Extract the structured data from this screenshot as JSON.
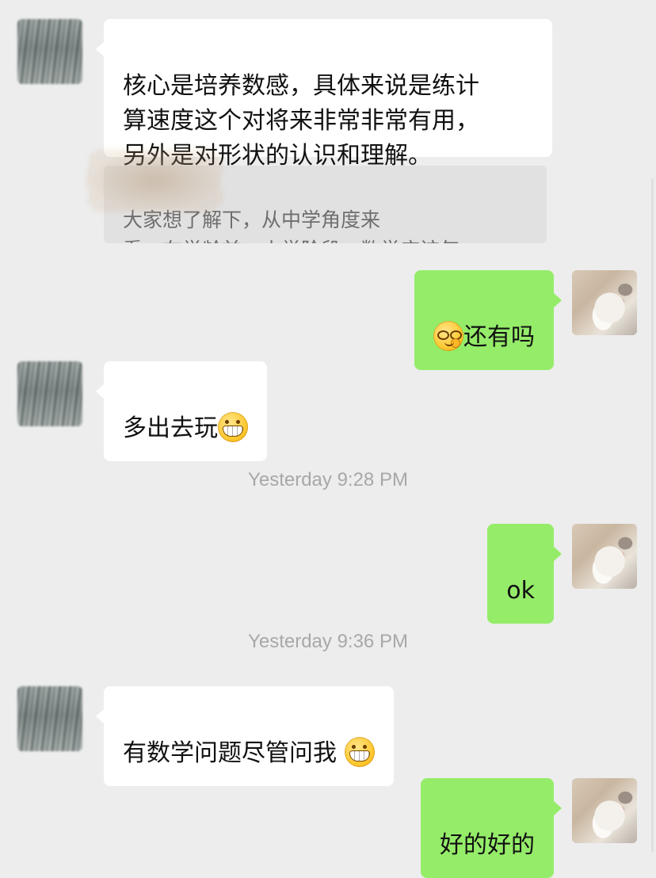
{
  "colors": {
    "background": "#ededed",
    "incoming_bubble": "#ffffff",
    "outgoing_bubble": "#95ec69",
    "quote_bg": "#e1e1e1",
    "timestamp_text": "#a8a8a8"
  },
  "messages": [
    {
      "sender": "other",
      "text": "核心是培养数感，具体来说是练计\n算速度这个对将来非常非常有用，\n另外是对形状的认识和理解。",
      "quote": {
        "text": "大家想了解下，从中学角度来\n看，在学龄前、小学阶段，数学应该怎..."
      }
    },
    {
      "sender": "self",
      "text": "还有吗",
      "emoji": "smug-face-emoji"
    },
    {
      "sender": "other",
      "text": "多出去玩",
      "emoji": "grinning-face-emoji"
    },
    {
      "timestamp": "Yesterday 9:28 PM"
    },
    {
      "sender": "self",
      "text": "ok"
    },
    {
      "timestamp": "Yesterday 9:36 PM"
    },
    {
      "sender": "other",
      "text": "有数学问题尽管问我 ",
      "emoji": "grinning-face-emoji"
    },
    {
      "sender": "self",
      "text": "好的好的"
    }
  ]
}
